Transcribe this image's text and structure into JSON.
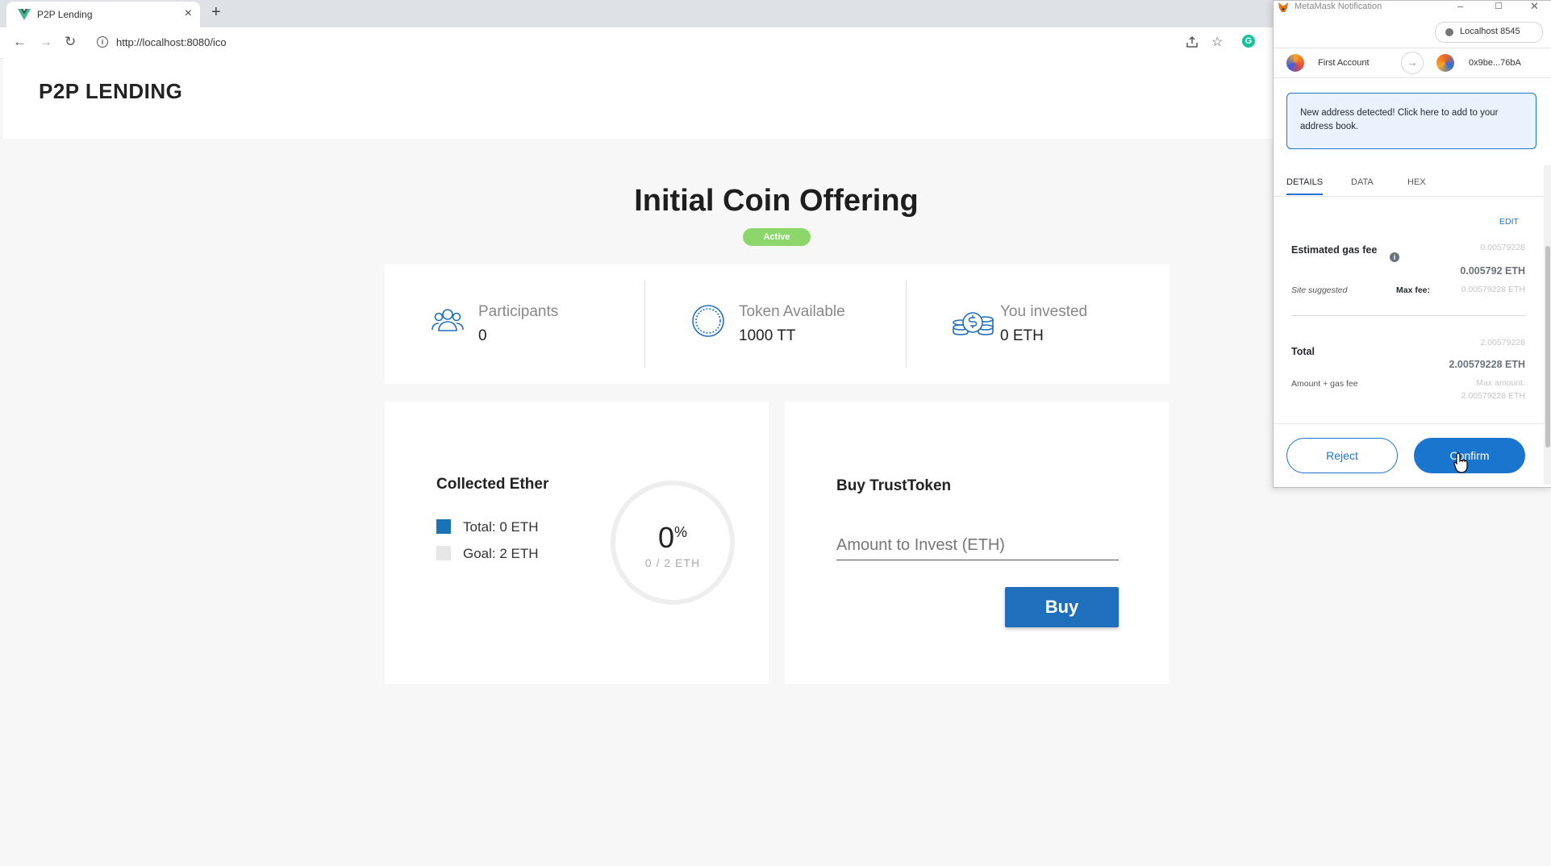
{
  "browser": {
    "tab_title": "P2P Lending",
    "tab_close": "×",
    "new_tab": "+",
    "url": "http://localhost:8080/ico",
    "nav": {
      "back": "←",
      "forward": "→",
      "reload": "↻"
    },
    "extension_letter": "G"
  },
  "app": {
    "brand": "P2P LENDING",
    "page_title": "Initial Coin Offering",
    "status_badge": "Active",
    "stats": [
      {
        "icon": "participants-icon",
        "label": "Participants",
        "value": "0"
      },
      {
        "icon": "token-coin-icon",
        "label": "Token Available",
        "value": "1000 TT"
      },
      {
        "icon": "money-stack-icon",
        "label": "You invested",
        "value": "0 ETH"
      }
    ],
    "collected": {
      "title": "Collected Ether",
      "total_label": "Total: 0 ETH",
      "goal_label": "Goal: 2 ETH",
      "percent": "0",
      "percent_sign": "%",
      "progress_text": "0 / 2 ETH",
      "progress_fraction": 0,
      "total_color": "#1a73b8",
      "goal_color": "#e6e6e6"
    },
    "buy": {
      "title": "Buy TrustToken",
      "amount_placeholder": "Amount to Invest (ETH)",
      "amount_value": "",
      "button": "Buy"
    }
  },
  "metamask": {
    "window_title": "MetaMask Notification",
    "network": "Localhost 8545",
    "from_account": "First Account",
    "to_address": "0x9be...76bA",
    "notice": "New address detected! Click here to add to your address book.",
    "tabs": [
      "DETAILS",
      "DATA",
      "HEX"
    ],
    "active_tab": "DETAILS",
    "edit": "EDIT",
    "gas": {
      "label": "Estimated gas fee",
      "faded_value": "0.00579228",
      "value": "0.005792 ETH",
      "site_suggested": "Site suggested",
      "max_fee_label": "Max fee:",
      "max_fee_value": "0.00579228 ETH"
    },
    "total": {
      "label": "Total",
      "faded_value": "2.00579228",
      "value": "2.00579228 ETH",
      "sub_label": "Amount + gas fee",
      "max_amount_label": "Max amount:",
      "max_amount_value": "2.00579228 ETH"
    },
    "buttons": {
      "reject": "Reject",
      "confirm": "Confirm"
    },
    "accent": "#1a75cf"
  }
}
